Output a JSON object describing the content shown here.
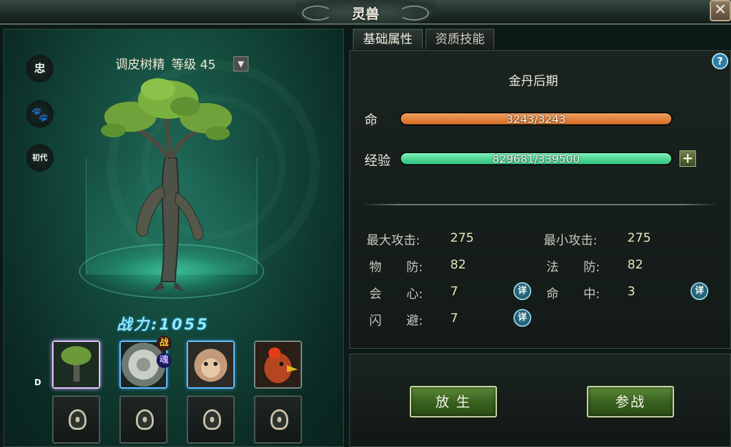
{
  "window": {
    "title": "灵兽",
    "close_label": "✕"
  },
  "left_panel": {
    "side_icons": [
      "忠",
      "🐾",
      "初代"
    ],
    "pet_name": "调皮树精",
    "level_label": "等级 45",
    "level_dropdown": "▼",
    "power_label": "战力:1055",
    "slots": [
      {
        "state": "selected",
        "pet": "tree-spirit"
      },
      {
        "state": "active",
        "pet": "white-tiger",
        "badges": [
          "战",
          "魂"
        ]
      },
      {
        "state": "active",
        "pet": "monkey"
      },
      {
        "state": "normal",
        "pet": "rooster"
      }
    ],
    "locked_slots": 4,
    "d_marker": "D"
  },
  "tabs": [
    {
      "label": "基础属性",
      "active": true
    },
    {
      "label": "资质技能",
      "active": false
    }
  ],
  "attributes": {
    "help_label": "?",
    "realm": "金丹后期",
    "life": {
      "label": "命",
      "text": "3243/3243",
      "fraction": 1.0
    },
    "exp": {
      "label": "经验",
      "text": "829681/339500",
      "fraction": 1.0,
      "plus_label": "+"
    },
    "stats": [
      {
        "label": "最大攻击:",
        "value": "275"
      },
      {
        "label": "最小攻击:",
        "value": "275"
      },
      {
        "label": "物　　防:",
        "value": "82"
      },
      {
        "label": "法　　防:",
        "value": "82"
      },
      {
        "label": "会　　心:",
        "value": "7"
      },
      {
        "label": "命　　中:",
        "value": "3"
      },
      {
        "label": "闪　　避:",
        "value": "7"
      }
    ],
    "detail_label": "详"
  },
  "actions": {
    "release": "放 生",
    "battle": "参战"
  },
  "colors": {
    "life_bar": "#e0802f",
    "exp_bar": "#38d08c",
    "power_text": "#8ee8ff",
    "stat_value": "#e9e2b5"
  }
}
